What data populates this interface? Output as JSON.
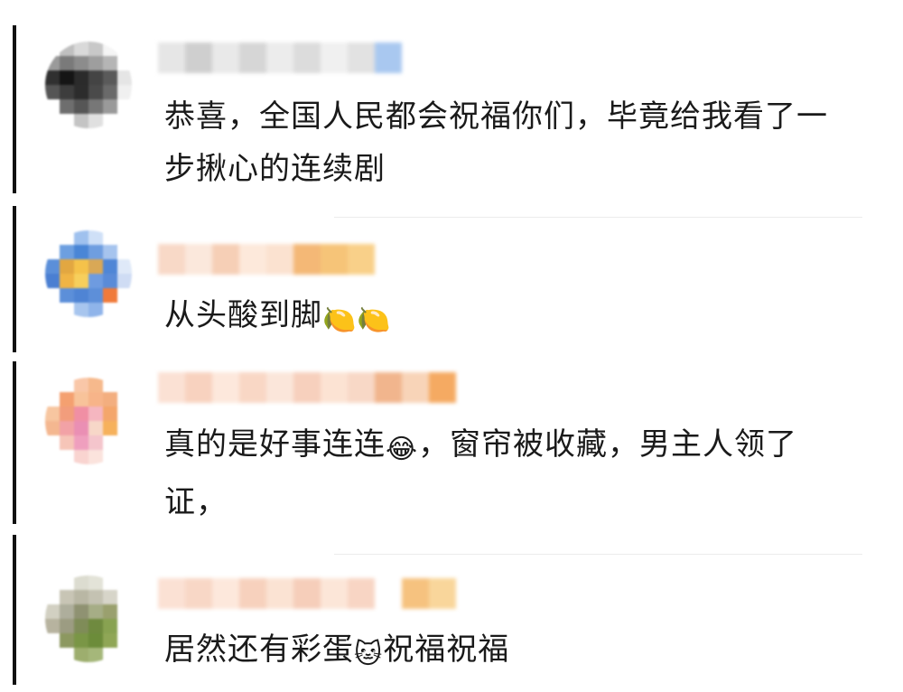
{
  "comments": [
    {
      "text": "恭喜，全国人民都会祝福你们，毕竟给我看了一步揪心的连续剧",
      "emojis": [],
      "avatar_colors": [
        "#ffffff",
        "#bfbfbf",
        "#d9d9d9",
        "#c8c8c8",
        "#f5f5f5",
        "#ffffff",
        "#9a9a9a",
        "#7a7a7a",
        "#8c8c8c",
        "#9e9e9e",
        "#b5b5b5",
        "#ffffff",
        "#303030",
        "#151515",
        "#2b2b2b",
        "#444",
        "#5a5a5a",
        "#e5e5e5",
        "#555",
        "#3d3d3d",
        "#2c2c2c",
        "#4a4a4a",
        "#6a6a6a",
        "#f0f0f0",
        "#ffffff",
        "#6e6e6e",
        "#565656",
        "#777",
        "#9a9a9a",
        "#ffffff",
        "#ffffff",
        "#ffffff",
        "#c4c4c4",
        "#e0e0e0",
        "#ffffff",
        "#ffffff"
      ],
      "name_colors": [
        "#e6e6e6",
        "#cfcfcf",
        "#e9e9e9",
        "#d6d6d6",
        "#ececec",
        "#dcdcdc",
        "#f0f0f0",
        "#e2e2e2",
        "#a9c8f0"
      ]
    },
    {
      "text": "从头酸到脚",
      "emojis": [
        "🍋",
        "🍋"
      ],
      "avatar_colors": [
        "#ffffff",
        "#ffffff",
        "#9fc1ee",
        "#cfe0f7",
        "#ffffff",
        "#ffffff",
        "#ffffff",
        "#6d9fe0",
        "#4a86d6",
        "#6f9ee0",
        "#a6c4ee",
        "#ffffff",
        "#5b8fd9",
        "#e2a741",
        "#f5c24a",
        "#d9a856",
        "#4f86d6",
        "#dfe9f8",
        "#4a7fd2",
        "#f0b445",
        "#f7cf5c",
        "#6e9be0",
        "#5a8bd8",
        "#cfdcf4",
        "#ffffff",
        "#5c8fd9",
        "#4f84d4",
        "#5d8fd9",
        "#f07a3a",
        "#ffffff",
        "#ffffff",
        "#ffffff",
        "#a7c5ee",
        "#8fb4ea",
        "#ffffff",
        "#ffffff"
      ],
      "name_colors": [
        "#f8d9c7",
        "#fbe8dc",
        "#f6cfb6",
        "#fde9db",
        "#fbe2d0",
        "#f4b876",
        "#f6c478",
        "#f9d089"
      ]
    },
    {
      "text": "真的是好事连连",
      "text2": "，窗帘被收藏，男主人领了证，",
      "emojis": [
        "😂"
      ],
      "avatar_colors": [
        "#ffffff",
        "#ffffff",
        "#f9c7a8",
        "#f6b98c",
        "#ffffff",
        "#ffffff",
        "#ffffff",
        "#f4a070",
        "#f8c39a",
        "#f7b489",
        "#f3ae7f",
        "#ffffff",
        "#f7c6a0",
        "#f29d7c",
        "#f08fa4",
        "#f5b6c0",
        "#f4a66b",
        "#ffffff",
        "#f4b790",
        "#f2a2a6",
        "#ea8fb4",
        "#f7d7c8",
        "#f6b15c",
        "#ffffff",
        "#ffffff",
        "#f6c5b8",
        "#ef9fbe",
        "#f4c5cc",
        "#ffffff",
        "#ffffff",
        "#ffffff",
        "#ffffff",
        "#f9d4d0",
        "#fbe3dd",
        "#ffffff",
        "#ffffff"
      ],
      "name_colors": [
        "#fbe1d4",
        "#f8d2bf",
        "#fde8dc",
        "#f9d7c5",
        "#fbe6da",
        "#f7d0bd",
        "#fce3d3",
        "#f8d8c6",
        "#f1b58d",
        "#f8d4b8",
        "#f5aa62"
      ]
    },
    {
      "text": "居然还有彩蛋",
      "text2": "祝福祝福",
      "emojis": [
        "🐱"
      ],
      "avatar_colors": [
        "#ffffff",
        "#ffffff",
        "#dcdcd0",
        "#e3e3d8",
        "#ffffff",
        "#ffffff",
        "#ffffff",
        "#c8c5b5",
        "#b9b7a4",
        "#c4c2b2",
        "#d7d5c9",
        "#ffffff",
        "#d2d0c2",
        "#aeae9c",
        "#8f9272",
        "#a6ad86",
        "#9aa06e",
        "#ffffff",
        "#b7b39f",
        "#9c9c82",
        "#7f8c58",
        "#6f8a3f",
        "#88a251",
        "#ffffff",
        "#ffffff",
        "#8c9860",
        "#7a9646",
        "#6c8c3a",
        "#8fa656",
        "#ffffff",
        "#ffffff",
        "#ffffff",
        "#9dae6e",
        "#a5b77a",
        "#ffffff",
        "#ffffff"
      ],
      "name_colors": [
        "#fbe1d4",
        "#f8d7c6",
        "#fde8dc",
        "#f7d1bd",
        "#fbe3d3",
        "#f6ceba",
        "#fce6d8",
        "#f8d5c4",
        "#ffffff",
        "#f6c27f",
        "#f9d69b"
      ]
    }
  ]
}
